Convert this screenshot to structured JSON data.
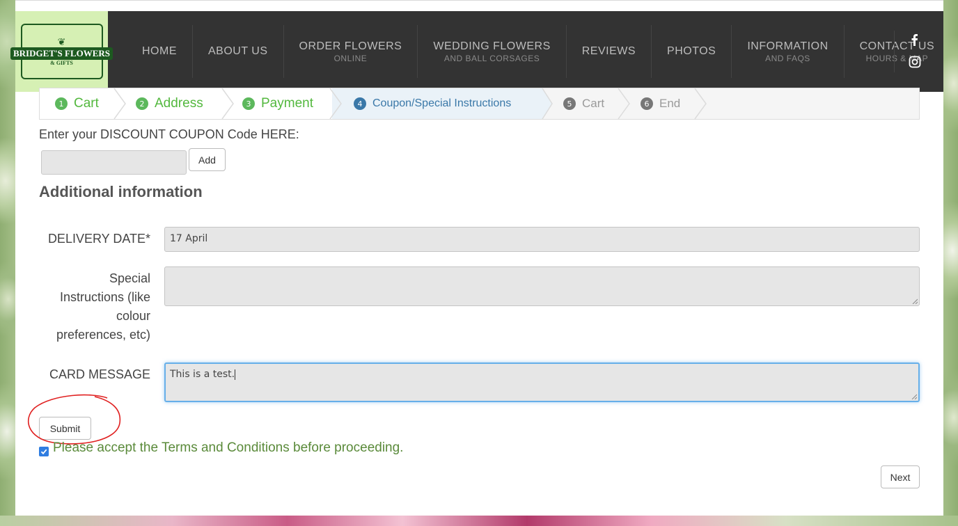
{
  "logo": {
    "title": "BRIDGET'S FLOWERS",
    "subtitle": "& GIFTS"
  },
  "nav": [
    {
      "label": "HOME",
      "sub": ""
    },
    {
      "label": "ABOUT US",
      "sub": ""
    },
    {
      "label": "ORDER FLOWERS",
      "sub": "ONLINE"
    },
    {
      "label": "WEDDING FLOWERS",
      "sub": "AND BALL CORSAGES"
    },
    {
      "label": "REVIEWS",
      "sub": ""
    },
    {
      "label": "PHOTOS",
      "sub": ""
    },
    {
      "label": "INFORMATION",
      "sub": "AND FAQS"
    },
    {
      "label": "CONTACT US",
      "sub": "HOURS & MAP"
    }
  ],
  "social": {
    "facebook": "facebook-icon",
    "instagram": "instagram-icon"
  },
  "steps": [
    {
      "num": "1",
      "label": "Cart",
      "state": "done"
    },
    {
      "num": "2",
      "label": "Address",
      "state": "done"
    },
    {
      "num": "3",
      "label": "Payment",
      "state": "done"
    },
    {
      "num": "4",
      "label": "Coupon/Special Instructions",
      "state": "active"
    },
    {
      "num": "5",
      "label": "Cart",
      "state": "todo"
    },
    {
      "num": "6",
      "label": "End",
      "state": "todo"
    }
  ],
  "coupon": {
    "label": "Enter your DISCOUNT COUPON Code HERE:",
    "value": "",
    "add_label": "Add"
  },
  "additional": {
    "title": "Additional information",
    "delivery_label": "DELIVERY DATE*",
    "delivery_value": "17 April",
    "special_label_lines": [
      "Special",
      "Instructions (like",
      "colour",
      "preferences, etc)"
    ],
    "special_value": "",
    "card_label": "CARD MESSAGE",
    "card_value": "This is a test."
  },
  "submit_label": "Submit",
  "terms_text": "Please accept the Terms and Conditions before proceeding.",
  "terms_checked": true,
  "next_label": "Next",
  "colors": {
    "header": "#333333",
    "logo_bg": "#d6f0b4",
    "done": "#5cb85c",
    "active": "#3a78a8",
    "annotation": "#e02020"
  }
}
